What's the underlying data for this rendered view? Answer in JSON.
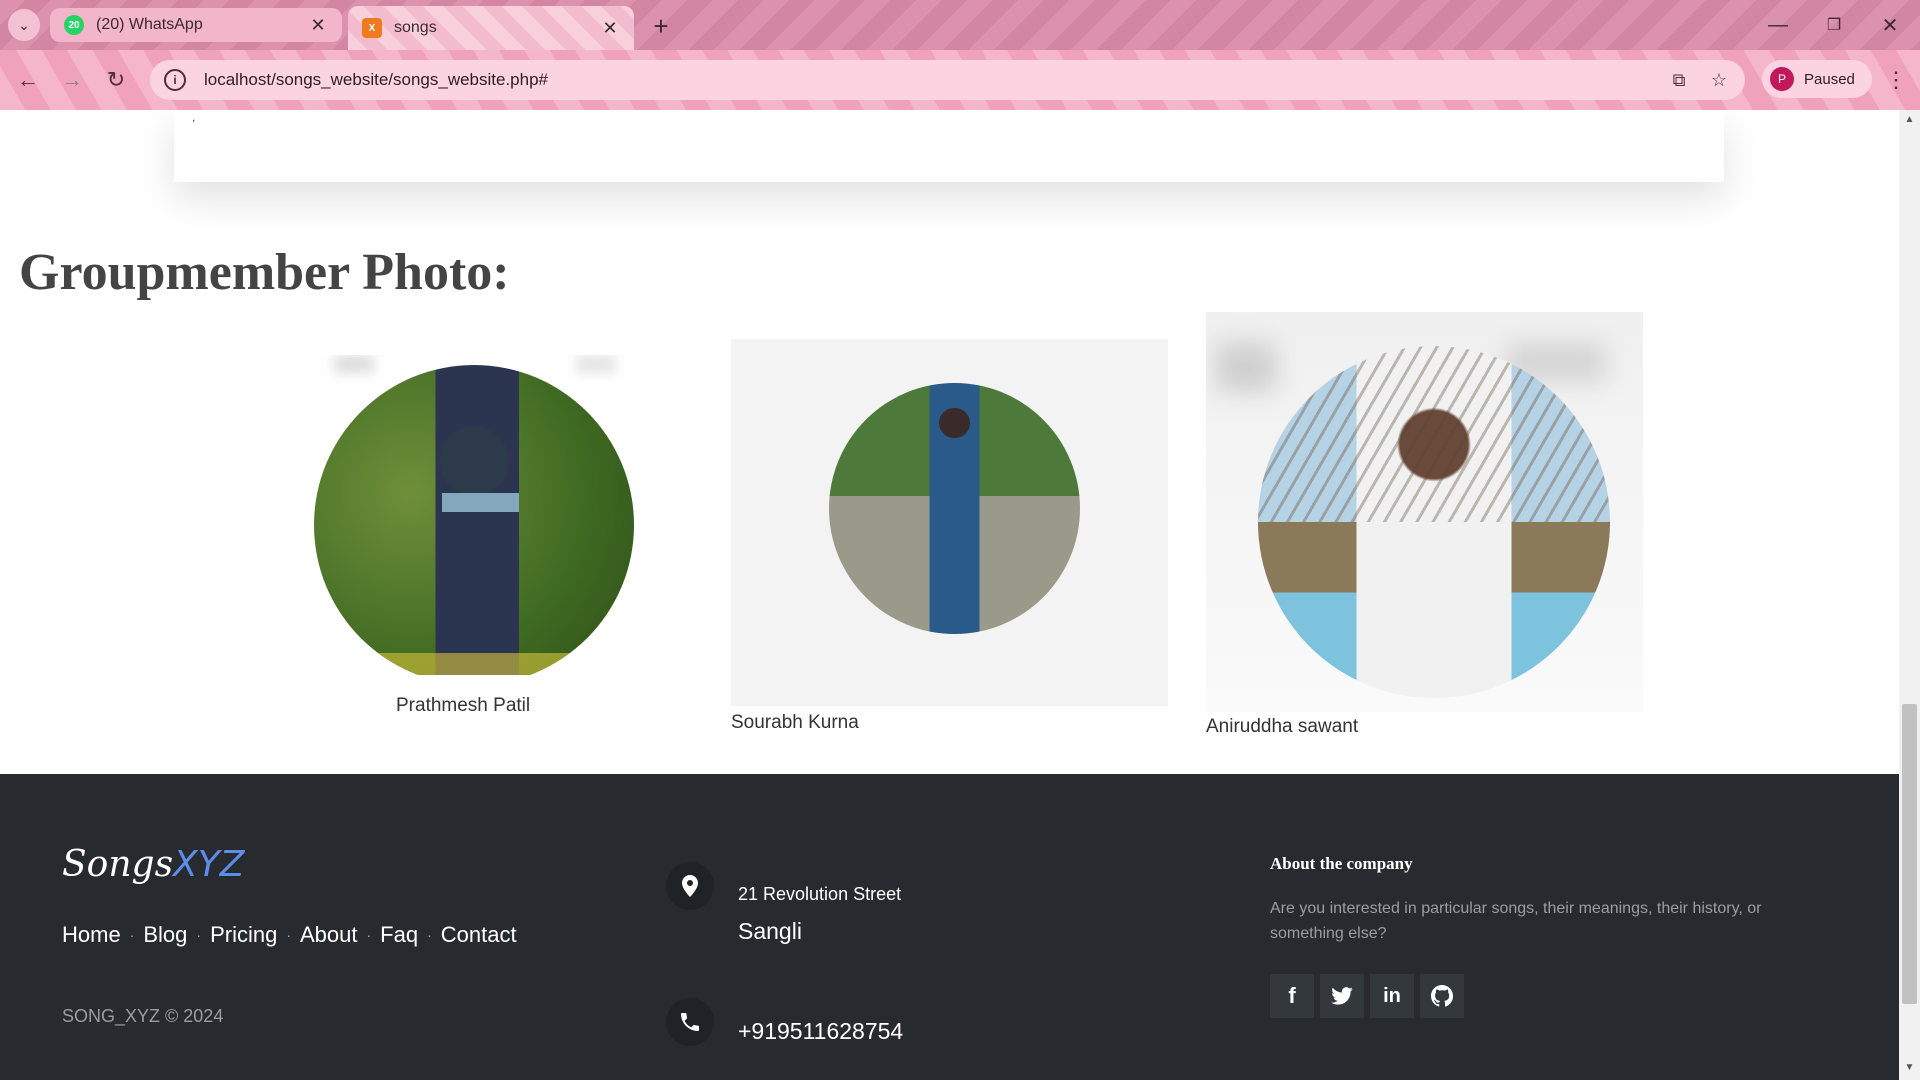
{
  "browser": {
    "tabs": [
      {
        "title": "(20) WhatsApp",
        "favicon": "whatsapp-icon",
        "favicon_text": "20"
      },
      {
        "title": "songs",
        "favicon": "xampp-icon",
        "favicon_text": "X"
      }
    ],
    "url": "localhost/songs_website/songs_website.php#",
    "profile_initial": "P",
    "profile_status": "Paused"
  },
  "page": {
    "card_tail_text": ",",
    "section_title": "Groupmember Photo:",
    "members": [
      {
        "name": "Prathmesh Patil"
      },
      {
        "name": "Sourabh Kurna"
      },
      {
        "name": "Aniruddha sawant"
      }
    ]
  },
  "footer": {
    "brand_main": "Songs",
    "brand_accent": "XYZ",
    "links": [
      "Home",
      "Blog",
      "Pricing",
      "About",
      "Faq",
      "Contact"
    ],
    "copyright": "SONG_XYZ © 2024",
    "address_street": "21 Revolution Street",
    "address_city": "Sangli",
    "phone": "+919511628754",
    "about_title": "About the company",
    "about_text": "Are you interested in particular songs, their meanings, their history, or something else?",
    "social": [
      {
        "icon": "facebook-icon",
        "glyph": "f"
      },
      {
        "icon": "twitter-icon",
        "glyph": "🐦"
      },
      {
        "icon": "linkedin-icon",
        "glyph": "in"
      },
      {
        "icon": "github-icon",
        "glyph": "◉"
      }
    ]
  },
  "colors": {
    "footer_bg": "#272b30",
    "brand_accent": "#5c8de8",
    "browser_frame": "#d98aa6"
  }
}
